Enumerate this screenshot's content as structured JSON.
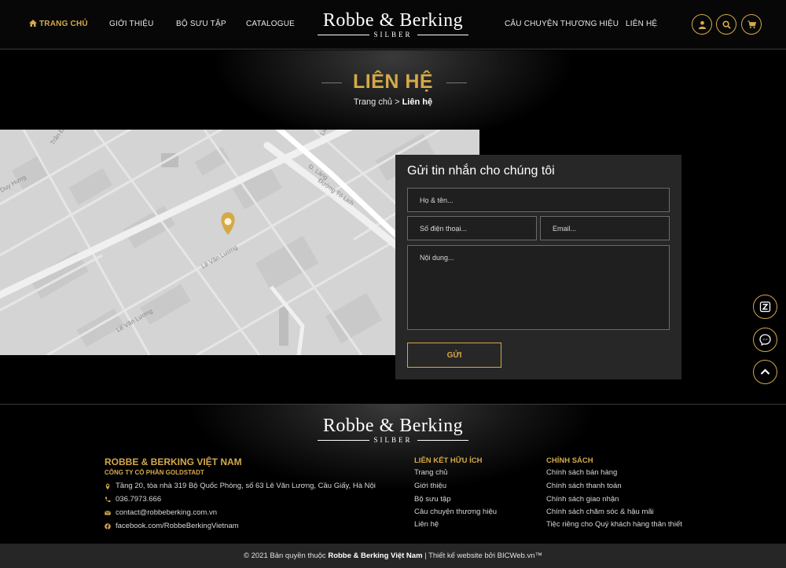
{
  "header": {
    "nav_left": [
      "Trang chủ",
      "Giới thiệu",
      "Bộ sưu tập",
      "Catalogue"
    ],
    "nav_right": [
      "Câu chuyện thương hiệu",
      "Liên hệ"
    ],
    "logo": {
      "main": "Robbe & Berking",
      "sub": "SILBER"
    }
  },
  "hero": {
    "title": "LIÊN HỆ",
    "breadcrumb_home": "Trang chủ",
    "breadcrumb_sep": " > ",
    "breadcrumb_current": "Liên hệ"
  },
  "map": {
    "labels": [
      "Trần Đ",
      "Duy Hưng",
      "Lê Văn Lương",
      "Lê Văn Lương",
      "Đ. Láng",
      "Đường Tô Lịch",
      "La"
    ]
  },
  "form": {
    "title": "Gửi tin nhắn cho chúng tôi",
    "name_placeholder": "Họ & tên...",
    "phone_placeholder": "Số điện thoại...",
    "email_placeholder": "Email...",
    "message_placeholder": "Nội dung...",
    "send_label": "GỬI"
  },
  "footer": {
    "logo": {
      "main": "Robbe & Berking",
      "sub": "SILBER"
    },
    "company_name": "ROBBE & BERKING VIỆT NAM",
    "company_subname": "CÔNG TY CỔ PHẦN GOLDSTADT",
    "address": "Tầng 20, tòa nhà 319 Bộ Quốc Phòng, số 63 Lê Văn Lương, Cầu Giấy, Hà Nội",
    "phone": "036.7973.666",
    "email": "contact@robbeberking.com.vn",
    "facebook": "facebook.com/RobbeBerkingVietnam",
    "links_title": "Liên kết hữu ích",
    "links": [
      "Trang chủ",
      "Giới thiệu",
      "Bộ sưu tập",
      "Câu chuyện thương hiệu",
      "Liên hệ"
    ],
    "policy_title": "Chính sách",
    "policies": [
      "Chính sách bán hàng",
      "Chính sách thanh toán",
      "Chính sách giao nhận",
      "Chính sách chăm sóc & hậu mãi",
      "Tiệc riêng cho Quý khách hàng thân thiết"
    ]
  },
  "copyright": {
    "prefix": "© 2021 Bản quyền thuộc",
    "owner": "Robbe & Berking Việt Nam",
    "suffix": "| Thiết kế website bởi BICWeb.vn™"
  },
  "colors": {
    "accent": "#d4a94a",
    "background": "#000000",
    "panel": "#272727",
    "map": "#d6d6d6"
  },
  "icons": [
    "home-icon",
    "user-icon",
    "search-icon",
    "cart-icon",
    "map-pin-icon",
    "zalo-icon",
    "messenger-icon",
    "chevron-up-icon",
    "phone-icon",
    "mail-icon",
    "facebook-icon"
  ]
}
